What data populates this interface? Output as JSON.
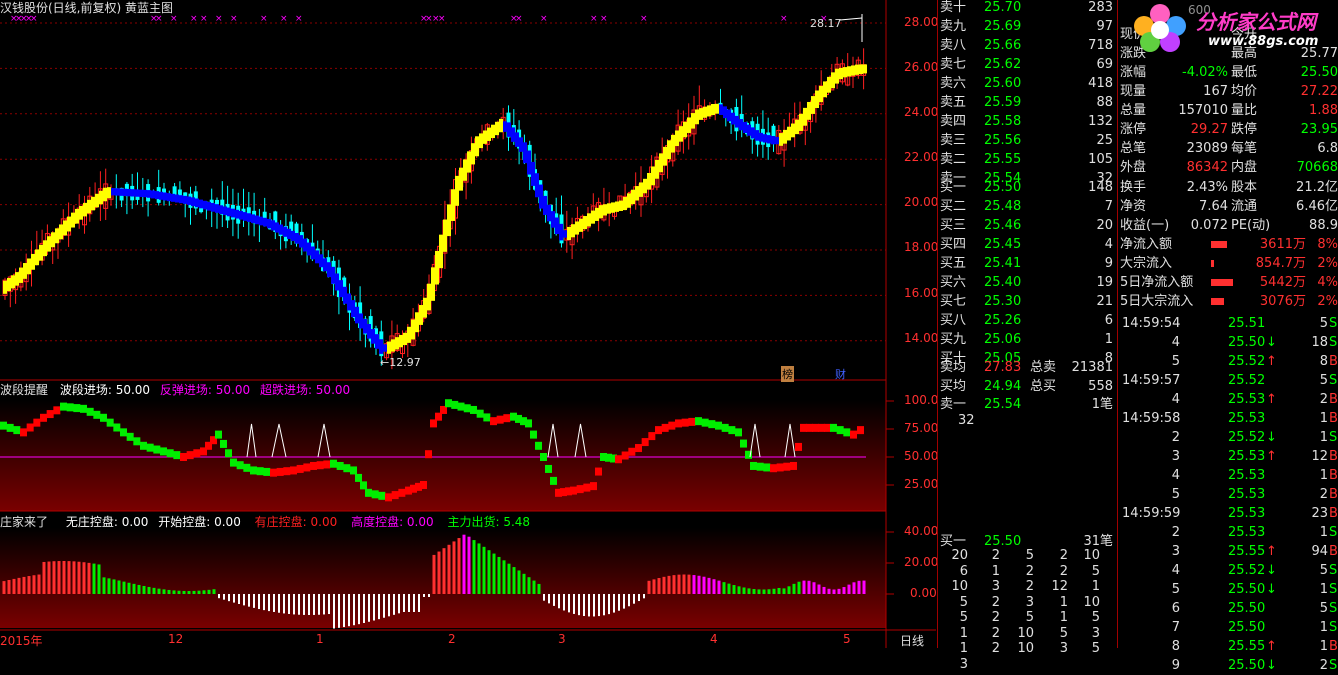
{
  "colors": {
    "up": "#ff2020",
    "down": "#00ffff",
    "wave_up": "#ffff00",
    "wave_down": "#0000ff",
    "panel_red": "#ff0000",
    "panel_green": "#00ee00",
    "magenta": "#ff00ff",
    "white": "#ffffff",
    "grid": "#a00000",
    "value_green": "#00ff00",
    "value_red": "#ff3030",
    "label_gray": "#c0c0c0"
  },
  "main_chart": {
    "title": "汉钱股份(日线,前复权) 黄蓝主图",
    "price_high_label": "28.17",
    "price_low_label": "12.97",
    "y_ticks": [
      "28.00",
      "26.00",
      "24.00",
      "22.00",
      "20.00",
      "18.00",
      "16.00",
      "14.00"
    ],
    "event_badges": [
      "榜",
      "财"
    ]
  },
  "wave_panel": {
    "title": "波段提醒",
    "lines": [
      {
        "label": "波段进场: 50.00",
        "color": "#ffffff"
      },
      {
        "label": "反弹进场: 50.00",
        "color": "#ff00ff"
      },
      {
        "label": "超跌进场: 50.00",
        "color": "#ff00ff"
      }
    ],
    "y_ticks": [
      "100.0",
      "75.00",
      "50.00",
      "25.00"
    ]
  },
  "dealer_panel": {
    "title": "庄家来了",
    "lines": [
      {
        "label": "无庄控盘: 0.00",
        "color": "#ffffff"
      },
      {
        "label": "开始控盘: 0.00",
        "color": "#ffffff"
      },
      {
        "label": "有庄控盘: 0.00",
        "color": "#ff2020"
      },
      {
        "label": "高度控盘: 0.00",
        "color": "#ff00ff"
      },
      {
        "label": "主力出货: 5.48",
        "color": "#00ff00"
      }
    ],
    "y_ticks": [
      "40.00",
      "20.00",
      "0.00"
    ]
  },
  "x_axis": {
    "labels": [
      "2015年",
      "12",
      "1",
      "2",
      "3",
      "4",
      "5"
    ],
    "period": "日线"
  },
  "watermark": {
    "site": "分析家公式网",
    "url": "www.88gs.com",
    "code": "600"
  },
  "order_book": {
    "asks": [
      {
        "label": "卖十",
        "price": "25.70",
        "vol": "283"
      },
      {
        "label": "卖九",
        "price": "25.69",
        "vol": "97"
      },
      {
        "label": "卖八",
        "price": "25.66",
        "vol": "718"
      },
      {
        "label": "卖七",
        "price": "25.62",
        "vol": "69"
      },
      {
        "label": "卖六",
        "price": "25.60",
        "vol": "418"
      },
      {
        "label": "卖五",
        "price": "25.59",
        "vol": "88"
      },
      {
        "label": "卖四",
        "price": "25.58",
        "vol": "132"
      },
      {
        "label": "卖三",
        "price": "25.56",
        "vol": "25"
      },
      {
        "label": "卖二",
        "price": "25.55",
        "vol": "105"
      },
      {
        "label": "卖一",
        "price": "25.54",
        "vol": "32"
      }
    ],
    "bids": [
      {
        "label": "买一",
        "price": "25.50",
        "vol": "148"
      },
      {
        "label": "买二",
        "price": "25.48",
        "vol": "7"
      },
      {
        "label": "买三",
        "price": "25.46",
        "vol": "20"
      },
      {
        "label": "买四",
        "price": "25.45",
        "vol": "4"
      },
      {
        "label": "买五",
        "price": "25.41",
        "vol": "9"
      },
      {
        "label": "买六",
        "price": "25.40",
        "vol": "19"
      },
      {
        "label": "买七",
        "price": "25.30",
        "vol": "21"
      },
      {
        "label": "买八",
        "price": "25.26",
        "vol": "6"
      },
      {
        "label": "买九",
        "price": "25.06",
        "vol": "1"
      },
      {
        "label": "买十",
        "price": "25.05",
        "vol": "8"
      }
    ],
    "avg_rows": [
      {
        "label": "卖均",
        "price": "27.83",
        "label2": "总卖",
        "vol": "21381"
      },
      {
        "label": "买均",
        "price": "24.94",
        "label2": "总买",
        "vol": "558"
      }
    ]
  },
  "queue": {
    "sell": {
      "label": "卖一",
      "price": "25.54",
      "count": "1笔",
      "items": [
        "32"
      ]
    },
    "buy": {
      "label": "买一",
      "price": "25.50",
      "count": "31笔",
      "grid": [
        [
          "20",
          "2",
          "5",
          "2",
          "10"
        ],
        [
          "6",
          "1",
          "2",
          "2",
          "5"
        ],
        [
          "10",
          "3",
          "2",
          "12",
          "1"
        ],
        [
          "5",
          "2",
          "3",
          "1",
          "10"
        ],
        [
          "5",
          "2",
          "5",
          "1",
          "5"
        ],
        [
          "1",
          "2",
          "10",
          "5",
          "3"
        ],
        [
          "1",
          "2",
          "10",
          "3",
          "5"
        ],
        [
          "3",
          "",
          "",
          "",
          ""
        ]
      ]
    }
  },
  "quote": {
    "rows": [
      {
        "l1": "现价",
        "v1": "",
        "l2": "今开",
        "v2": ""
      },
      {
        "l1": "涨跌",
        "v1": "",
        "l2": "最高",
        "v2": "25.77"
      },
      {
        "l1": "涨幅",
        "v1": "-4.02%",
        "l2": "最低",
        "v2": "25.50"
      },
      {
        "l1": "现量",
        "v1": "167",
        "l2": "均价",
        "v2": "27.22"
      },
      {
        "l1": "总量",
        "v1": "157010",
        "l2": "量比",
        "v2": "1.88"
      },
      {
        "l1": "涨停",
        "v1": "29.27",
        "l2": "跌停",
        "v2": "23.95"
      },
      {
        "l1": "总笔",
        "v1": "23089",
        "l2": "每笔",
        "v2": "6.8"
      },
      {
        "l1": "外盘",
        "v1": "86342",
        "l2": "内盘",
        "v2": "70668"
      }
    ],
    "fin": [
      {
        "l1": "换手",
        "v1": "2.43%",
        "l2": "股本",
        "v2": "21.2亿"
      },
      {
        "l1": "净资",
        "v1": "7.64",
        "l2": "流通",
        "v2": "6.46亿"
      },
      {
        "l1": "收益(一)",
        "v1": "0.072",
        "l2": "PE(动)",
        "v2": "88.9"
      }
    ],
    "flows": [
      {
        "label": "净流入额",
        "value": "3611万",
        "pct": "8%"
      },
      {
        "label": "大宗流入",
        "value": "854.7万",
        "pct": "2%"
      },
      {
        "label": "5日净流入额",
        "value": "5442万",
        "pct": "4%"
      },
      {
        "label": "5日大宗流入",
        "value": "3076万",
        "pct": "2%"
      }
    ]
  },
  "ticks": [
    {
      "time": "14:59:54",
      "price": "25.51",
      "vol": "5",
      "side": "S",
      "arrow": ""
    },
    {
      "time": "4",
      "price": "25.50",
      "vol": "18",
      "side": "S",
      "arrow": "↓"
    },
    {
      "time": "5",
      "price": "25.52",
      "vol": "8",
      "side": "B",
      "arrow": "↑"
    },
    {
      "time": "14:59:57",
      "price": "25.52",
      "vol": "5",
      "side": "S",
      "arrow": ""
    },
    {
      "time": "4",
      "price": "25.53",
      "vol": "2",
      "side": "B",
      "arrow": "↑"
    },
    {
      "time": "14:59:58",
      "price": "25.53",
      "vol": "1",
      "side": "B",
      "arrow": ""
    },
    {
      "time": "2",
      "price": "25.52",
      "vol": "1",
      "side": "S",
      "arrow": "↓"
    },
    {
      "time": "3",
      "price": "25.53",
      "vol": "12",
      "side": "B",
      "arrow": "↑"
    },
    {
      "time": "4",
      "price": "25.53",
      "vol": "1",
      "side": "B",
      "arrow": ""
    },
    {
      "time": "5",
      "price": "25.53",
      "vol": "2",
      "side": "B",
      "arrow": ""
    },
    {
      "time": "14:59:59",
      "price": "25.53",
      "vol": "23",
      "side": "B",
      "arrow": ""
    },
    {
      "time": "2",
      "price": "25.53",
      "vol": "1",
      "side": "S",
      "arrow": ""
    },
    {
      "time": "3",
      "price": "25.55",
      "vol": "94",
      "side": "B",
      "arrow": "↑"
    },
    {
      "time": "4",
      "price": "25.52",
      "vol": "5",
      "side": "S",
      "arrow": "↓"
    },
    {
      "time": "5",
      "price": "25.50",
      "vol": "1",
      "side": "S",
      "arrow": "↓"
    },
    {
      "time": "6",
      "price": "25.50",
      "vol": "5",
      "side": "S",
      "arrow": ""
    },
    {
      "time": "7",
      "price": "25.50",
      "vol": "1",
      "side": "S",
      "arrow": ""
    },
    {
      "time": "8",
      "price": "25.55",
      "vol": "1",
      "side": "B",
      "arrow": "↑"
    },
    {
      "time": "9",
      "price": "25.50",
      "vol": "2",
      "side": "S",
      "arrow": "↓"
    }
  ]
}
